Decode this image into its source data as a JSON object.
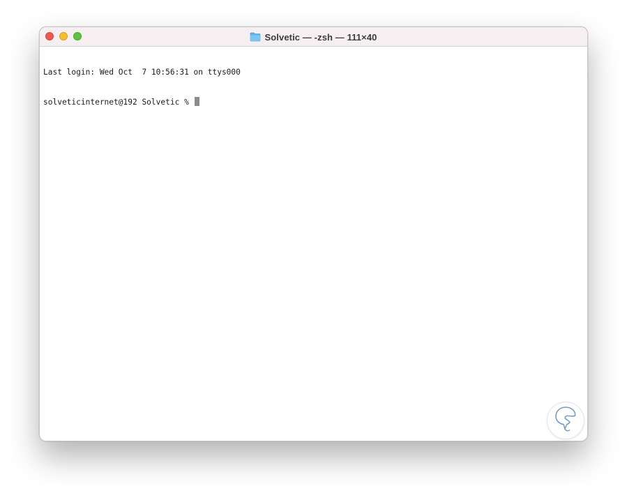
{
  "window": {
    "title": "Solvetic — -zsh — 111×40",
    "title_icon": "folder-icon",
    "traffic_lights": {
      "close_color": "#ee5a52",
      "minimize_color": "#f5bd2f",
      "zoom_color": "#5ec43f"
    }
  },
  "terminal": {
    "lines": [
      "Last login: Wed Oct  7 10:56:31 on ttys000",
      "solveticinternet@192 Solvetic % "
    ],
    "text_color": "#1b1b1b",
    "background": "#ffffff"
  },
  "watermark": {
    "icon": "solvetic-logo-icon",
    "color": "#7a9bbd"
  }
}
